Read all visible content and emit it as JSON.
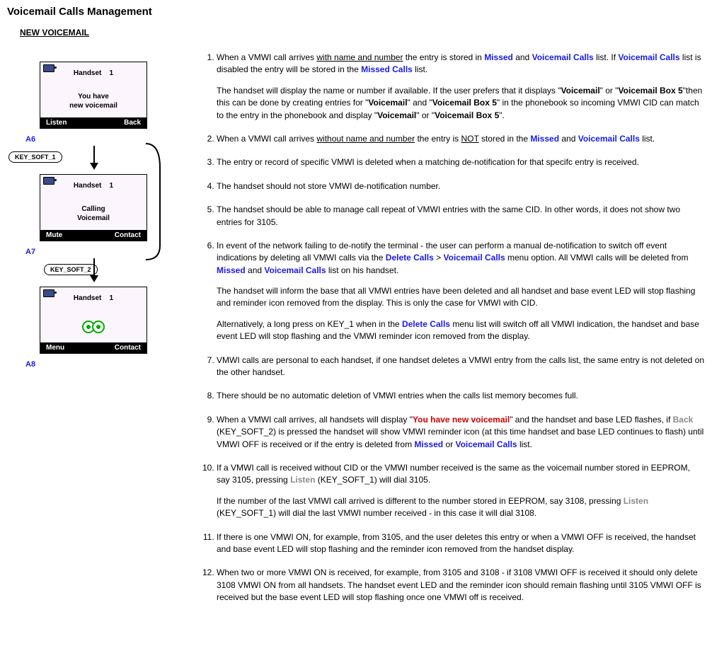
{
  "page_title": "Voicemail Calls Management",
  "section_subtitle": "NEW VOICEMAIL",
  "phones": {
    "A6": {
      "id": "A6",
      "handset": "Handset",
      "handset_num": "1",
      "message_l1": "You have",
      "message_l2": "new voicemail",
      "soft_left": "Listen",
      "soft_right": "Back"
    },
    "A7": {
      "id": "A7",
      "handset": "Handset",
      "handset_num": "1",
      "message_l1": "Calling",
      "message_l2": "Voicemail",
      "soft_left": "Mute",
      "soft_right": "Contact"
    },
    "A8": {
      "id": "A8",
      "handset": "Handset",
      "handset_num": "1",
      "soft_left": "Menu",
      "soft_right": "Contact"
    }
  },
  "keys": {
    "soft1": "KEY_SOFT_1",
    "soft2": "KEY_SOFT_2"
  },
  "text": {
    "r1_a": "When a VMWI call arrives ",
    "r1_u": "with name and number",
    "r1_b": " the entry is stored in ",
    "missed": "Missed",
    "r1_and": " and ",
    "vc_list": "Voicemail Calls",
    "r1_c": " list. If ",
    "r1_d": " list is disabled the entry will be stored in the ",
    "missed_calls": "Missed Calls",
    "r1_e": " list.",
    "r1_p2a": "The handset will display the name or number if available. If the user prefers that it displays \"",
    "voicemail_b": "Voicemail",
    "r1_p2b": "\" or \"",
    "vb5": "Voicemail Box 5",
    "r1_p2c": "\"then this can be done by creating entries for \"",
    "r1_p2d": "\" and \"",
    "r1_p2e": "\" in the phonebook so incoming VMWI CID can match to the entry in the phonebook and display \"",
    "r1_p2f": "\" or \"",
    "r1_p2g": "\".",
    "r2_a": "When a VMWI call arrives ",
    "r2_u": "without name and number",
    "r2_b": " the entry is ",
    "r2_not": "NOT",
    "r2_c": " stored in the ",
    "r2_d": " list.",
    "r3": "The entry or record of specific VMWI is deleted when a matching de-notification for that specifc entry is received.",
    "r4": "The handset should not store VMWI de-notification number.",
    "r5": "The handset should be able to manage call repeat of VMWI entries with the same CID. In other words, it does not show two entries for 3105.",
    "r6_p1a": "In event of the network failing to de-notify the terminal - the user can perform a manual de-notification to switch off event indications by deleting all VMWI calls via the ",
    "delete_calls": "Delete Calls",
    "gt": " > ",
    "r6_p1b": " menu option. All VMWI calls will be deleted from ",
    "r6_p1c": " list on his handset.",
    "r6_p2": "The handset will inform the base that all VMWI entries have been deleted and all handset and base event LED will stop flashing and reminder icon removed from the display. This is only the case for VMWI with CID.",
    "r6_p3a": "Alternatively, a long press on KEY_1 when in the ",
    "r6_p3b": " menu list will switch off all VMWI indication, the handset and base event LED will stop flashing and the VMWI reminder icon removed from the display.",
    "r7": "VMWI calls are personal to each handset, if one handset deletes a VMWI entry from the calls list, the same entry is not deleted on the other handset.",
    "r8": "There should be no automatic deletion of VMWI entries when the calls list memory becomes full.",
    "r9_a": "When a VMWI call arrives, all handsets will display \"",
    "r9_red": "You have new voicemail",
    "r9_b": "\" and the handset and base LED flashes, if ",
    "back_g": "Back",
    "r9_c": " (KEY_SOFT_2) is pressed the handset will show VMWI reminder icon (at this time handset and base LED continues to flash) until VMWI OFF is received or if the entry is deleted from ",
    "or": " or ",
    "r9_d": " list.",
    "r10_p1a": "If a VMWI call is received without CID or the VMWI number received is the same as the voicemail number stored in EEPROM, say 3105, pressing ",
    "listen_g": "Listen",
    "r10_p1b": " (KEY_SOFT_1) will dial 3105.",
    "r10_p2a": "If the number of the last VMWI call arrived is different to the number stored in EEPROM, say 3108, pressing ",
    "r10_p2b": " (KEY_SOFT_1) will dial the last VMWI number received - in this case it will dial 3108.",
    "r11": "If there is one VMWI ON, for example, from 3105, and the user deletes this entry or when a VMWI OFF is received, the handset and base event LED will stop flashing and the reminder icon removed from the handset display.",
    "r12": "When two or more VMWI ON is received, for example, from 3105 and 3108 - if 3108 VMWI OFF is received it should only delete 3108 VMWI ON from all handsets. The handset event LED and the reminder icon should remain flashing until 3105 VMWI OFF is received but the base event LED will stop flashing once one VMWI off is received."
  }
}
